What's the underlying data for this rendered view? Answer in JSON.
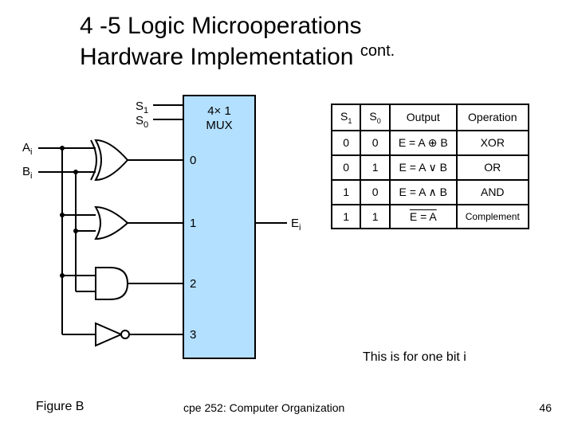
{
  "title": {
    "line1": "4 -5 Logic Microoperations",
    "line2": "Hardware Implementation",
    "suffix": "cont."
  },
  "diagram": {
    "input_a": "A",
    "input_a_sub": "i",
    "input_b": "B",
    "input_b_sub": "i",
    "sel1": "S",
    "sel1_sub": "1",
    "sel0": "S",
    "sel0_sub": "0",
    "mux_title_1": "4× 1",
    "mux_title_2": "MUX",
    "mux_in0": "0",
    "mux_in1": "1",
    "mux_in2": "2",
    "mux_in3": "3",
    "output": "E",
    "output_sub": "i"
  },
  "table": {
    "headers": {
      "s1": "S",
      "s1_sub": "1",
      "s0": "S",
      "s0_sub": "0",
      "out": "Output",
      "op": "Operation"
    },
    "rows": [
      {
        "s1": "0",
        "s0": "0",
        "out": "E = A ⊕ B",
        "op": "XOR"
      },
      {
        "s1": "0",
        "s0": "1",
        "out": "E = A ∨ B",
        "op": "OR"
      },
      {
        "s1": "1",
        "s0": "0",
        "out": "E =  A ∧ B",
        "op": "AND"
      },
      {
        "s1": "1",
        "s0": "1",
        "out": "E = A",
        "op": "Complement"
      }
    ]
  },
  "note": "This is for one bit i",
  "figure_caption": "Figure B",
  "footer": "cpe 252: Computer Organization",
  "page": "46",
  "chart_data": {
    "type": "table",
    "title": "4-5 Logic Microoperations Hardware Implementation (4×1 MUX truth table)",
    "columns": [
      "S1",
      "S0",
      "Output",
      "Operation"
    ],
    "rows": [
      [
        "0",
        "0",
        "E = A XOR B",
        "XOR"
      ],
      [
        "0",
        "1",
        "E = A OR B",
        "OR"
      ],
      [
        "1",
        "0",
        "E = A AND B",
        "AND"
      ],
      [
        "1",
        "1",
        "E = NOT A",
        "Complement"
      ]
    ],
    "circuit": {
      "inputs": [
        "A_i",
        "B_i",
        "S1",
        "S0"
      ],
      "gates": [
        "XOR",
        "OR",
        "AND",
        "NOT"
      ],
      "mux": "4x1",
      "output": "E_i"
    }
  }
}
